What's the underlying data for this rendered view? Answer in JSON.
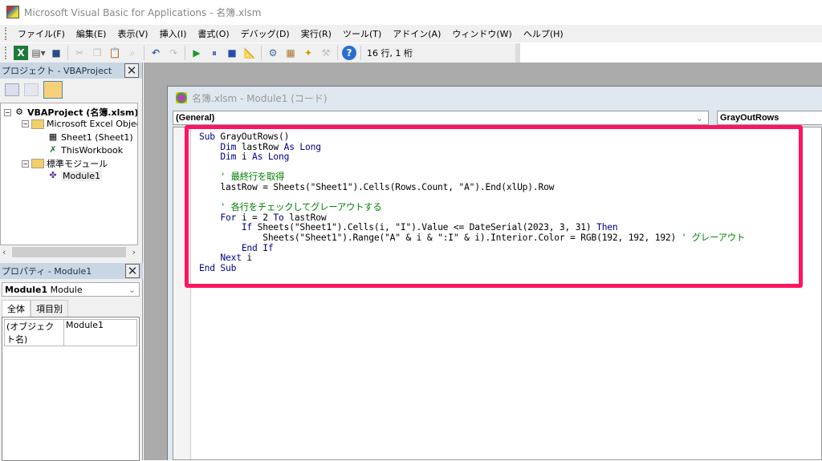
{
  "window": {
    "title": "Microsoft Visual Basic for Applications - 名簿.xlsm"
  },
  "menu": [
    "ファイル(F)",
    "編集(E)",
    "表示(V)",
    "挿入(I)",
    "書式(O)",
    "デバッグ(D)",
    "実行(R)",
    "ツール(T)",
    "アドイン(A)",
    "ウィンドウ(W)",
    "ヘルプ(H)"
  ],
  "toolbar": {
    "position": "16 行, 1 桁"
  },
  "project": {
    "title": "プロジェクト - VBAProject",
    "root": "VBAProject (名簿.xlsm)",
    "folder1": "Microsoft Excel Objects",
    "sheet1": "Sheet1 (Sheet1)",
    "workbook": "ThisWorkbook",
    "folder2": "標準モジュール",
    "module": "Module1"
  },
  "properties": {
    "title": "プロパティ - Module1",
    "object_name": "Module1",
    "object_type": "Module",
    "tab_all": "全体",
    "tab_category": "項目別",
    "prop_name": "(オブジェクト名)",
    "prop_value": "Module1"
  },
  "code_window": {
    "title": "名簿.xlsm - Module1 (コード)",
    "object_combo": "(General)",
    "proc_combo": "GrayOutRows",
    "lines": [
      [
        [
          "k",
          "Sub "
        ],
        [
          "n",
          "GrayOutRows()"
        ]
      ],
      [
        [
          "n",
          "    "
        ],
        [
          "k",
          "Dim "
        ],
        [
          "n",
          "lastRow "
        ],
        [
          "k",
          "As Long"
        ]
      ],
      [
        [
          "n",
          "    "
        ],
        [
          "k",
          "Dim "
        ],
        [
          "n",
          "i "
        ],
        [
          "k",
          "As Long"
        ]
      ],
      [
        [
          "n",
          ""
        ]
      ],
      [
        [
          "c",
          "    ' 最終行を取得"
        ]
      ],
      [
        [
          "n",
          "    lastRow = Sheets(\"Sheet1\").Cells(Rows.Count, \"A\").End(xlUp).Row"
        ]
      ],
      [
        [
          "n",
          ""
        ]
      ],
      [
        [
          "c",
          "    ' 各行をチェックしてグレーアウトする"
        ]
      ],
      [
        [
          "n",
          "    "
        ],
        [
          "k",
          "For "
        ],
        [
          "n",
          "i = 2 "
        ],
        [
          "k",
          "To "
        ],
        [
          "n",
          "lastRow"
        ]
      ],
      [
        [
          "n",
          "        "
        ],
        [
          "k",
          "If "
        ],
        [
          "n",
          "Sheets(\"Sheet1\").Cells(i, \"I\").Value <= DateSerial(2023, 3, 31) "
        ],
        [
          "k",
          "Then"
        ]
      ],
      [
        [
          "n",
          "            Sheets(\"Sheet1\").Range(\"A\" & i & \":I\" & i).Interior.Color = RGB(192, 192, 192) "
        ],
        [
          "c",
          "' グレーアウト"
        ]
      ],
      [
        [
          "n",
          "        "
        ],
        [
          "k",
          "End If"
        ]
      ],
      [
        [
          "n",
          "    "
        ],
        [
          "k",
          "Next "
        ],
        [
          "n",
          "i"
        ]
      ],
      [
        [
          "k",
          "End Sub"
        ]
      ]
    ]
  },
  "colors": {
    "highlight": "#ff1460",
    "keyword": "#00008b",
    "comment": "#008000"
  }
}
